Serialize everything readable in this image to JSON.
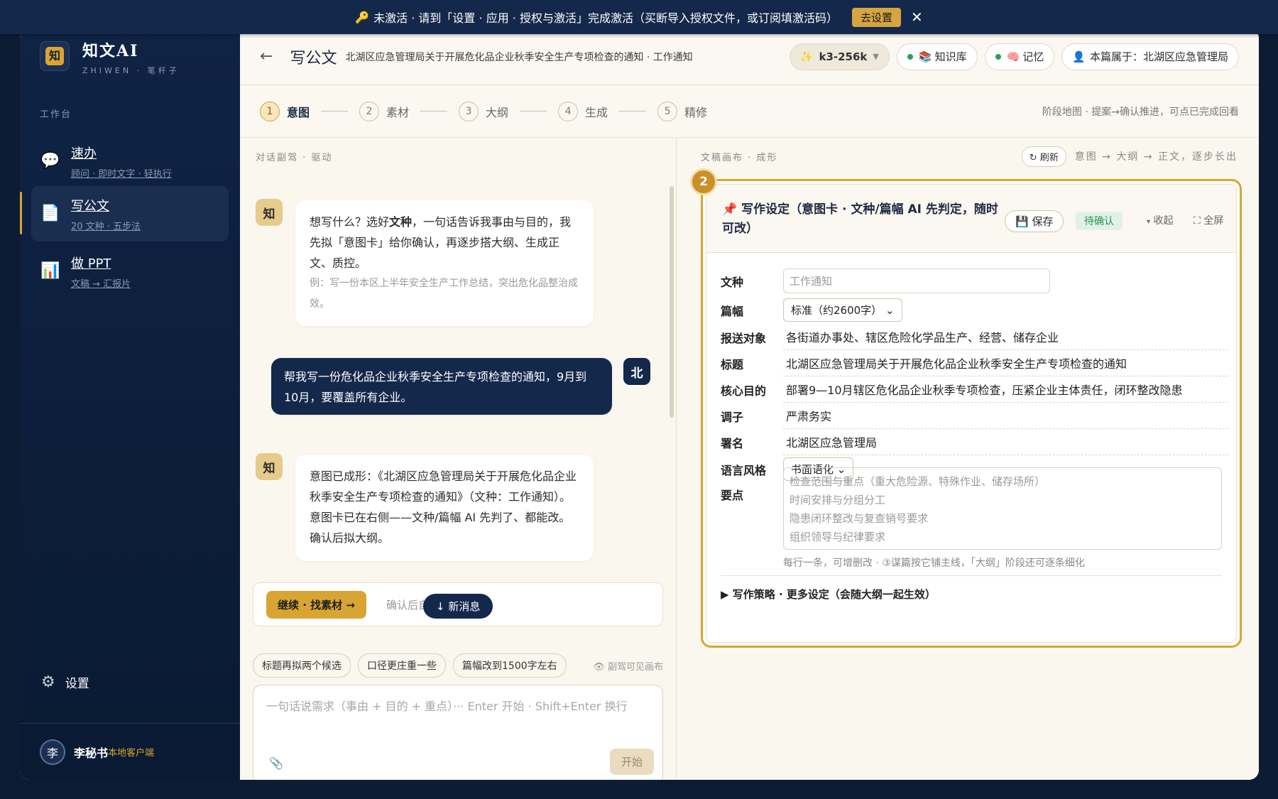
{
  "banner": {
    "text": "未激活 · 请到「设置 · 应用 · 授权与激活」完成激活（买断导入授权文件，或订阅填激活码）",
    "button": "去设置"
  },
  "sidebar": {
    "app_name": "知文AI",
    "app_sub": "ZHIWEN · 笔杆子",
    "logo_char": "知",
    "section": "工作台",
    "items": [
      {
        "label": "速办",
        "sub": "顾问 · 即时文字 · 轻执行"
      },
      {
        "label": "写公文",
        "sub": "20 文种 · 五步法"
      },
      {
        "label": "做 PPT",
        "sub": "文稿 → 汇报片"
      }
    ],
    "settings": "设置",
    "user": {
      "avatar": "李",
      "name": "李秘书",
      "client": "本地客户端"
    }
  },
  "topbar": {
    "title": "写公文",
    "desc": "北湖区应急管理局关于开展危化品企业秋季安全生产专项检查的通知 · 工作通知",
    "model": "k3-256k",
    "kb": "知识库",
    "memory": "记忆",
    "owner": "本篇属于：北湖区应急管理局"
  },
  "steps": {
    "items": [
      {
        "n": "1",
        "label": "意图"
      },
      {
        "n": "2",
        "label": "素材"
      },
      {
        "n": "3",
        "label": "大纲"
      },
      {
        "n": "4",
        "label": "生成"
      },
      {
        "n": "5",
        "label": "精修"
      }
    ],
    "hint": "阶段地图 · 提案→确认推进，可点已完成回看"
  },
  "chat": {
    "header": "对话副驾 · 驱动",
    "bot_char": "知",
    "user_char": "北",
    "m1_a": "想写什么？选好",
    "m1_b": "文种",
    "m1_c": "，一句话告诉我事由与目的，我先拟「意图卡」给你确认，再逐步搭大纲、生成正文、质控。",
    "m1_example": "例：写一份本区上半年安全生产工作总结，突出危化品整治成效。",
    "m2": "帮我写一份危化品企业秋季安全生产专项检查的通知，9月到10月，要覆盖所有企业。",
    "m3": "意图已成形：《北湖区应急管理局关于开展危化品企业秋季安全生产专项检查的通知》（文种：工作通知）。意图卡已在右侧——文种/篇幅 AI 先判了、都能改。确认后拟大纲。",
    "continue": "继续 · 找素材 →",
    "continue_hint": "确认后自动跳",
    "new_msg": "↓ 新消息",
    "chips": [
      "标题再拟两个候选",
      "口径更庄重一些",
      "篇幅改到1500字左右"
    ],
    "visible": "副驾可见画布",
    "input_placeholder": "一句话说需求（事由 + 目的 + 重点）··· Enter 开始 · Shift+Enter 换行",
    "send": "开始"
  },
  "canvas": {
    "header": "文稿画布 · 成形",
    "refresh": "↻ 刷新",
    "flow": "意图 → 大纲 → 正文，逐步长出",
    "card": {
      "num": "2",
      "title": "写作设定（意图卡 · 文种/篇幅 AI 先判定，随时可改）",
      "save": "保存",
      "status": "待确认",
      "fold": "收起",
      "full": "全屏",
      "f_type": "文种",
      "type_placeholder": "工作通知",
      "f_len": "篇幅",
      "len_value": "标准（约2600字）",
      "f_to": "报送对象",
      "to": "各街道办事处、辖区危险化学品生产、经营、储存企业",
      "f_title": "标题",
      "title_value": "北湖区应急管理局关于开展危化品企业秋季安全生产专项检查的通知",
      "f_goal": "核心目的",
      "goal": "部署9—10月辖区危化品企业秋季专项检查，压紧企业主体责任，闭环整改隐患",
      "f_tone": "调子",
      "tone": "严肃务实",
      "f_sign": "署名",
      "sign": "北湖区应急管理局",
      "f_style": "语言风格",
      "style_value": "书面语化",
      "f_points": "要点",
      "points": [
        "检查范围与重点（重大危险源、特殊作业、储存场所）",
        "时间安排与分组分工",
        "隐患闭环整改与复查销号要求",
        "组织领导与纪律要求"
      ],
      "points_hint": "每行一条，可增删改 · ③谋篇按它铺主线，「大纲」阶段还可逐条细化",
      "strategy": "写作策略 · 更多设定（会随大纲一起生效）"
    }
  }
}
